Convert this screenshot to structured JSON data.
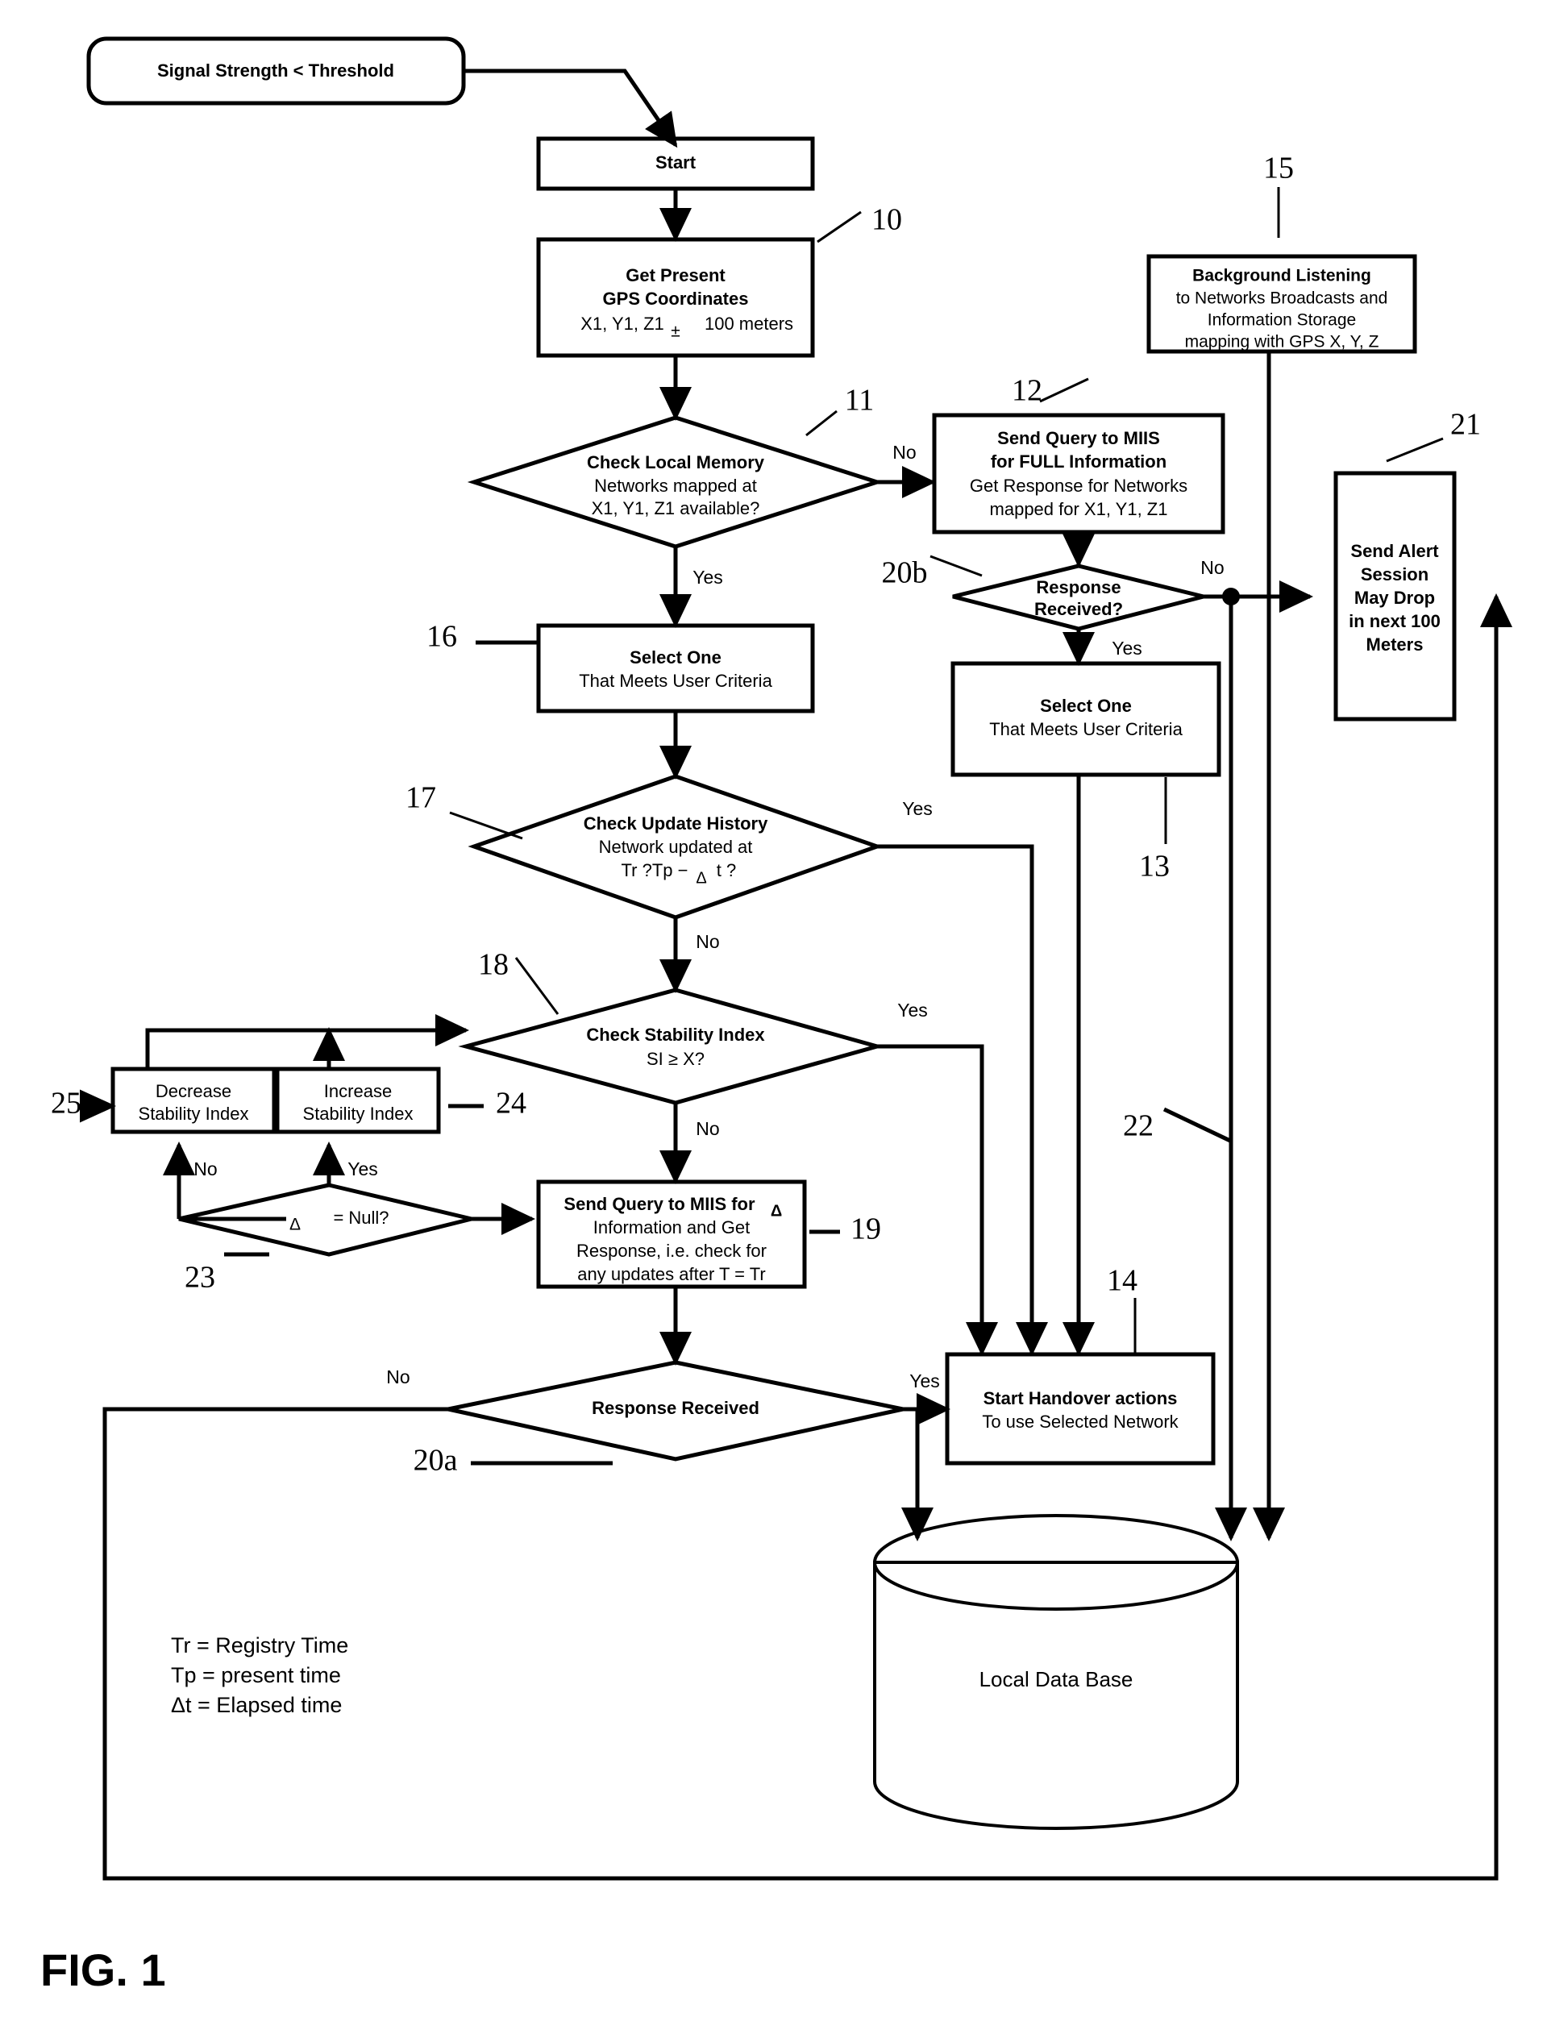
{
  "figure": {
    "label": "FIG. 1",
    "type": "patent-flowchart"
  },
  "nodes": {
    "trigger": {
      "id": "trigger",
      "shape": "rounded-rect",
      "lines": [
        "Signal Strength < Threshold"
      ],
      "bold": [
        true
      ]
    },
    "start": {
      "id": "start",
      "shape": "rect",
      "lines": [
        "Start"
      ],
      "bold": [
        true
      ]
    },
    "gps": {
      "id": "gps",
      "ref": "10",
      "shape": "rect",
      "line1": "Get Present",
      "line2": "GPS Coordinates",
      "line3a": "X1, Y1, Z1",
      "line3b": "±",
      "line3c": "100 meters"
    },
    "check_local_memory": {
      "id": "check_local_memory",
      "ref": "11",
      "shape": "diamond",
      "line1": "Check Local Memory",
      "line2": "Networks mapped at",
      "line3": "X1, Y1, Z1 available?"
    },
    "send_query_full": {
      "id": "send_query_full",
      "ref": "12",
      "shape": "rect",
      "line1": "Send Query to MIIS",
      "line2": "for FULL Information",
      "line3": "Get Response for Networks",
      "line4": "mapped for X1, Y1, Z1"
    },
    "background_listening": {
      "id": "background_listening",
      "ref": "15",
      "shape": "rect",
      "line1": "Background Listening",
      "line2": "to Networks Broadcasts and",
      "line3": "Information Storage",
      "line4": "mapping with GPS X, Y, Z"
    },
    "response_received_b": {
      "id": "response_received_b",
      "ref": "20b",
      "shape": "diamond",
      "line1": "Response",
      "line2": "Received?"
    },
    "send_alert": {
      "id": "send_alert",
      "ref": "21",
      "shape": "rect",
      "line1": "Send Alert",
      "line2": "Session",
      "line3": "May Drop",
      "line4": "in next 100",
      "line5": "Meters"
    },
    "select_one_16": {
      "id": "select_one_16",
      "ref": "16",
      "shape": "rect",
      "line1": "Select One",
      "line2": "That Meets User Criteria"
    },
    "select_one_13": {
      "id": "select_one_13",
      "ref": "13",
      "shape": "rect",
      "line1": "Select One",
      "line2": "That Meets User Criteria"
    },
    "check_update_history": {
      "id": "check_update_history",
      "ref": "17",
      "shape": "diamond",
      "line1": "Check Update History",
      "line2": "Network updated at",
      "line3a": "Tr ?Tp −",
      "line3b": "Δ",
      "line3c": "t ?"
    },
    "check_stability_index": {
      "id": "check_stability_index",
      "ref": "18",
      "shape": "diamond",
      "line1": "Check Stability Index",
      "line2": "SI ≥ X?"
    },
    "decrease_si": {
      "id": "decrease_si",
      "ref": "25",
      "shape": "rect",
      "line1": "Decrease",
      "line2": "Stability Index"
    },
    "increase_si": {
      "id": "increase_si",
      "ref": "24",
      "shape": "rect",
      "line1": "Increase",
      "line2": "Stability Index"
    },
    "delta_null": {
      "id": "delta_null",
      "ref": "23",
      "shape": "diamond",
      "line1a": "Δ",
      "line1b": "= Null?"
    },
    "send_query_delta": {
      "id": "send_query_delta",
      "ref": "19",
      "shape": "rect",
      "line1a": "Send Query to MIIS for",
      "line1b": "Δ",
      "line2": "Information and Get",
      "line3": "Response, i.e. check for",
      "line4": "any updates after T = Tr"
    },
    "response_received_a": {
      "id": "response_received_a",
      "ref": "20a",
      "shape": "diamond",
      "line1": "Response Received"
    },
    "start_handover": {
      "id": "start_handover",
      "ref": "14",
      "shape": "rect",
      "line1": "Start Handover actions",
      "line2": "To use Selected Network"
    },
    "local_database": {
      "id": "local_database",
      "shape": "cylinder",
      "line1": "Local Data Base"
    },
    "ref22": {
      "id": "ref22",
      "ref": "22"
    }
  },
  "edge_labels": {
    "no_local_memory": "No",
    "yes_local_memory": "Yes",
    "no_response_b": "No",
    "yes_response_b": "Yes",
    "yes_update_history": "Yes",
    "no_update_history": "No",
    "yes_stability": "Yes",
    "no_stability": "No",
    "no_delta_null": "No",
    "yes_delta_null": "Yes",
    "no_response_a": "No",
    "yes_response_a": "Yes"
  },
  "legend": {
    "line1": "Tr = Registry   Time",
    "line2": "Tp = present time",
    "line3": "Δt = Elapsed time"
  },
  "colors": {
    "stroke": "#000000",
    "fill": "#ffffff",
    "background": "#ffffff"
  }
}
